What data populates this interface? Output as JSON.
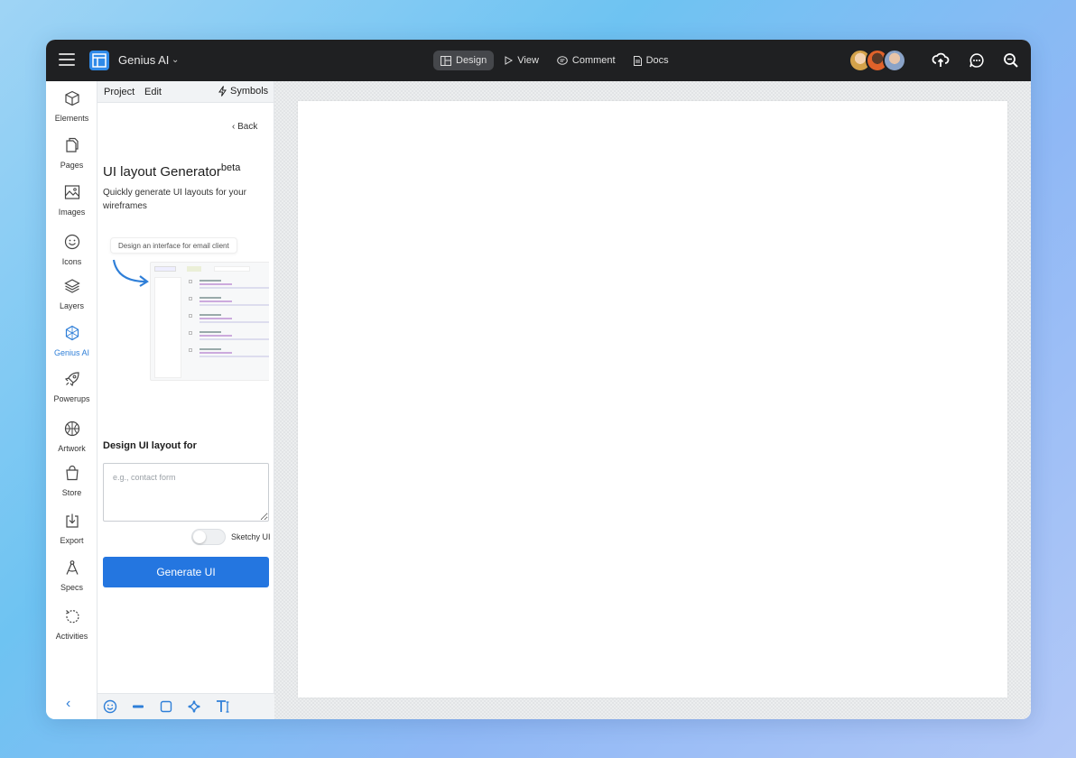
{
  "app": {
    "name": "Genius AI",
    "colors": {
      "accent": "#2476e0",
      "topbar": "#1f2022",
      "active_rail": "#2f7fd8"
    }
  },
  "topbar": {
    "tabs": [
      {
        "label": "Design",
        "icon": "layout-icon",
        "active": true
      },
      {
        "label": "View",
        "icon": "play-icon",
        "active": false
      },
      {
        "label": "Comment",
        "icon": "comment-icon",
        "active": false
      },
      {
        "label": "Docs",
        "icon": "document-icon",
        "active": false
      }
    ],
    "right_icons": [
      "upload-cloud-icon",
      "chat-icon",
      "zoom-search-icon"
    ]
  },
  "rail": {
    "items": [
      {
        "label": "Elements",
        "icon": "cube-icon"
      },
      {
        "label": "Pages",
        "icon": "pages-icon"
      },
      {
        "label": "Images",
        "icon": "image-icon"
      },
      {
        "label": "Icons",
        "icon": "smiley-icon"
      },
      {
        "label": "Layers",
        "icon": "layers-icon"
      },
      {
        "label": "Genius AI",
        "icon": "genius-ai-icon",
        "active": true
      },
      {
        "label": "Powerups",
        "icon": "rocket-icon"
      },
      {
        "label": "Artwork",
        "icon": "artwork-icon"
      },
      {
        "label": "Store",
        "icon": "bag-icon"
      },
      {
        "label": "Export",
        "icon": "export-icon"
      },
      {
        "label": "Specs",
        "icon": "compass-icon"
      },
      {
        "label": "Activities",
        "icon": "history-icon"
      }
    ],
    "collapse": "‹"
  },
  "panel": {
    "header": {
      "project": "Project",
      "edit": "Edit",
      "symbols": "Symbols"
    },
    "back": "Back",
    "title": "UI layout Generator",
    "title_sup": "beta",
    "description": "Quickly generate UI layouts for your wireframes",
    "illustration": {
      "prompt": "Design an interface for email client"
    },
    "section_label": "Design UI layout for",
    "input": {
      "placeholder": "e.g., contact form",
      "value": ""
    },
    "toggle": {
      "label": "Sketchy UI",
      "on": false
    },
    "generate_button": "Generate UI"
  },
  "bottom_tools": [
    "smiley-tool-icon",
    "line-tool-icon",
    "rectangle-tool-icon",
    "move-tool-icon",
    "text-tool-icon",
    "balsamiq-icon"
  ]
}
